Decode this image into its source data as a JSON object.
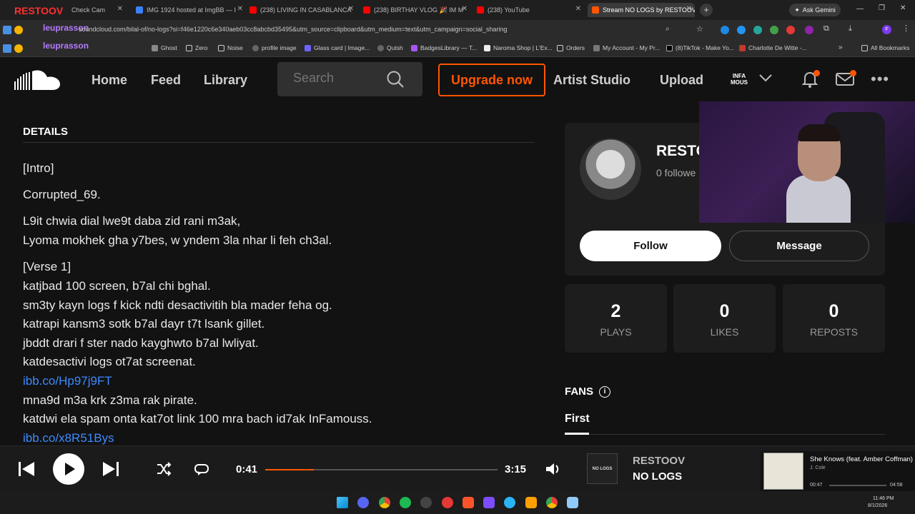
{
  "browser": {
    "tabs": [
      {
        "label": "Check Cam"
      },
      {
        "label": "IMG 1924 hosted at ImgBB — I"
      },
      {
        "label": "(238) LIVING IN CASABLANCA"
      },
      {
        "label": "(238) BIRTHAY VLOG 🎉 IM M"
      },
      {
        "label": "(238) YouTube"
      },
      {
        "label": "Stream NO LOGS by RESTOOV"
      }
    ],
    "ask_gemini": "Ask Gemini",
    "url": "soundcloud.com/bilal-of/no-logs?si=f46e1220c6e340aeb03cc8abcbd35495&utm_source=clipboard&utm_medium=text&utm_campaign=social_sharing",
    "bookmarks": [
      {
        "label": "Ghost"
      },
      {
        "label": "Zero"
      },
      {
        "label": "Noise"
      },
      {
        "label": "profile image"
      },
      {
        "label": "Glass card | Image..."
      },
      {
        "label": "Qutsh"
      },
      {
        "label": "BadgesLibrary — T..."
      },
      {
        "label": "Naroma Shop | L'Ex..."
      },
      {
        "label": "Orders"
      },
      {
        "label": "My Account - My Pr..."
      },
      {
        "label": "(8)TikTok - Make Yo..."
      },
      {
        "label": "Charlotte De Witte -..."
      }
    ],
    "all_bookmarks": "All Bookmarks"
  },
  "overlay": {
    "channel": "RESTOOV",
    "user1": "leuprasson",
    "user2": "leuprasson"
  },
  "header": {
    "home": "Home",
    "feed": "Feed",
    "library": "Library",
    "search_placeholder": "Search",
    "upgrade": "Upgrade now",
    "artist_studio": "Artist Studio",
    "upload": "Upload",
    "user_badge": "INFA MOUS"
  },
  "details": {
    "heading": "DETAILS",
    "lines": [
      "[Intro]",
      "Corrupted_69.",
      "L9it chwia dial lwe9t daba zid rani m3ak,",
      "Lyoma mokhek gha y7bes, w yndem 3la nhar li feh ch3al.",
      "[Verse 1]",
      "katjbad 100 screen, b7al chi bghal.",
      "sm3ty kayn logs f kick ndti desactivitih bla mader feha og.",
      "katrapi kansm3 sotk b7al dayr t7t lsank gillet.",
      "jbddt drari f ster nado kayghwto b7al lwliyat.",
      "katdesactivi logs ot7at screenat.",
      "ibb.co/Hp97j9FT",
      "mna9d m3a krk z3ma rak pirate.",
      "katdwi ela spam onta kat7ot link 100 mra bach id7ak InFamouss.",
      "ibb.co/x8R51Bys"
    ]
  },
  "profile": {
    "name": "RESTO",
    "followers": "0 followe",
    "follow": "Follow",
    "message": "Message"
  },
  "stats": [
    {
      "num": "2",
      "label": "PLAYS"
    },
    {
      "num": "0",
      "label": "LIKES"
    },
    {
      "num": "0",
      "label": "REPOSTS"
    }
  ],
  "fans": {
    "title": "FANS",
    "tab": "First"
  },
  "player": {
    "current": "0:41",
    "total": "3:15",
    "progress_fraction": 0.21,
    "art_text": "NO LOGS",
    "artist": "RESTOOV",
    "title": "NO LOGS"
  },
  "spotify": {
    "title": "She Knows (feat. Amber Coffman)",
    "artist": "J. Cole",
    "current": "00:47",
    "total": "04:58"
  },
  "taskbar": {
    "time": "11:46 PM",
    "date": "8/1/2026"
  },
  "colors": {
    "accent": "#ff5500",
    "link": "#3d8bff"
  }
}
